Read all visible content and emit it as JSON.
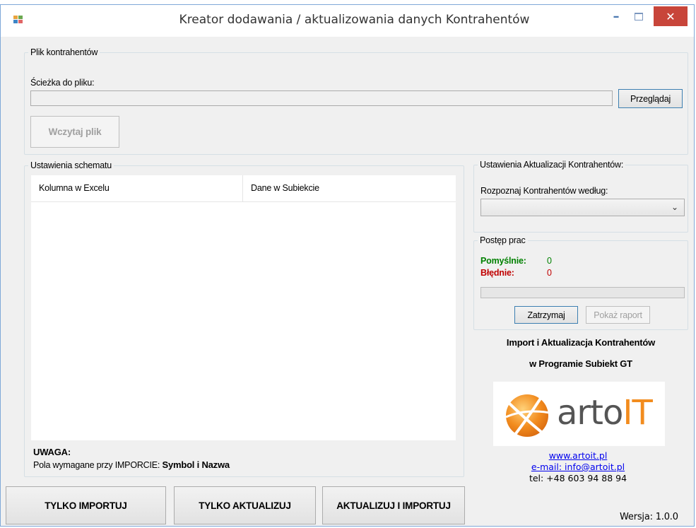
{
  "window": {
    "title": "Kreator dodawania / aktualizowania danych Kontrahentów",
    "min_glyph": "–",
    "close_glyph": "✕"
  },
  "file_group": {
    "legend": "Plik kontrahentów",
    "path_label": "Ścieżka do pliku:",
    "path_value": "",
    "browse_label": "Przeglądaj",
    "load_label": "Wczytaj plik"
  },
  "schema_group": {
    "legend": "Ustawienia schematu",
    "columns": [
      "Kolumna w Excelu",
      "Dane w Subiekcie"
    ],
    "rows": [],
    "note_title": "UWAGA:",
    "note_text": "Pola wymagane przy IMPORCIE:",
    "note_bold": "Symbol i Nazwa"
  },
  "update_group": {
    "legend": "Ustawienia Aktualizacji Kontrahentów:",
    "recognize_label": "Rozpoznaj Kontrahentów według:",
    "recognize_value": ""
  },
  "progress_group": {
    "legend": "Postęp prac",
    "success_label": "Pomyślnie:",
    "success_value": "0",
    "error_label": "Błędnie:",
    "error_value": "0",
    "progress_fraction": 0,
    "stop_label": "Zatrzymaj",
    "report_label": "Pokaż raport"
  },
  "promo": {
    "line1": "Import i Aktualizacja Kontrahentów",
    "line2": "w Programie Subiekt GT",
    "logo_text_a": "arto",
    "logo_text_b": "IT",
    "website": "www.artoit.pl",
    "email": "e-mail: info@artoit.pl",
    "phone": "tel: +48 603 94 88 94"
  },
  "actions": {
    "import_only": "TYLKO IMPORTUJ",
    "update_only": "TYLKO AKTUALIZUJ",
    "update_and_import": "AKTUALIZUJ I IMPORTUJ"
  },
  "version": "Wersja: 1.0.0",
  "colors": {
    "success": "#008000",
    "error": "#c00000",
    "logo_orange": "#f28c1e",
    "logo_gray": "#555555",
    "close_red": "#c8453a"
  }
}
